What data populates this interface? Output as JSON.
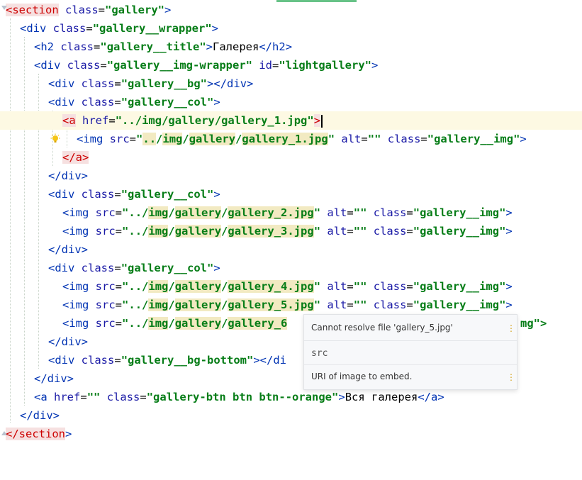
{
  "editor": {
    "lines": [
      [
        "<",
        "section",
        " class",
        "=",
        "\"gallery\"",
        ">"
      ],
      [],
      [],
      [],
      [],
      [],
      [],
      [],
      [],
      [],
      [],
      [],
      [],
      [],
      [],
      [],
      [],
      [],
      [],
      [],
      [],
      [],
      [],
      []
    ],
    "l0": {
      "lt": "<",
      "tag": "section",
      "attr": " class",
      "eq": "=",
      "val": "\"gallery\"",
      "gt": ">"
    },
    "l1": {
      "lt": "<",
      "tag": "div",
      "attr": " class",
      "eq": "=",
      "val": "\"gallery__wrapper\"",
      "gt": ">"
    },
    "l2": {
      "lt": "<",
      "tag": "h2",
      "attr": " class",
      "eq": "=",
      "val": "\"gallery__title\"",
      "gt": ">",
      "text": "Галерея",
      "close_lt": "</",
      "close_tag": "h2",
      "close_gt": ">"
    },
    "l3": {
      "lt": "<",
      "tag": "div",
      "attr": " class",
      "eq": "=",
      "val": "\"gallery__img-wrapper\"",
      "attr2": " id",
      "eq2": "=",
      "val2": "\"lightgallery\"",
      "gt": ">"
    },
    "l4": {
      "lt": "<",
      "tag": "div",
      "attr": " class",
      "eq": "=",
      "val": "\"gallery__bg\"",
      "gt": ">",
      "close_lt": "</",
      "close_tag": "div",
      "close_gt": ">"
    },
    "l5": {
      "lt": "<",
      "tag": "div",
      "attr": " class",
      "eq": "=",
      "val": "\"gallery__col\"",
      "gt": ">"
    },
    "l6": {
      "lt": "<",
      "tag": "a",
      "attr": " href",
      "eq": "=",
      "q1": "\"",
      "p1": "..",
      "s1": "/",
      "p2": "img",
      "s2": "/",
      "p3": "gallery",
      "s3": "/",
      "p4": "gallery_1.jpg",
      "q2": "\"",
      "gt": ">"
    },
    "l7": {
      "lt": "<",
      "tag": "img",
      "attr": " src",
      "eq": "=",
      "q1": "\"",
      "p1": "..",
      "s1": "/",
      "p2": "img",
      "s2": "/",
      "p3": "gallery",
      "s3": "/",
      "p4": "gallery_1.jpg",
      "q2": "\"",
      "attr2": " alt",
      "eq2": "=",
      "val2": "\"\"",
      "attr3": " class",
      "eq3": "=",
      "val3": "\"gallery__img\"",
      "gt": ">"
    },
    "l8": {
      "lt": "</",
      "tag": "a",
      "gt": ">"
    },
    "l9": {
      "lt": "</",
      "tag": "div",
      "gt": ">"
    },
    "l10": {
      "lt": "<",
      "tag": "div",
      "attr": " class",
      "eq": "=",
      "val": "\"gallery__col\"",
      "gt": ">"
    },
    "l11": {
      "lt": "<",
      "tag": "img",
      "attr": " src",
      "eq": "=",
      "q1": "\"",
      "p1": "..",
      "s1": "/",
      "p2": "img",
      "s2": "/",
      "p3": "gallery",
      "s3": "/",
      "p4": "gallery_2.jpg",
      "q2": "\"",
      "attr2": " alt",
      "eq2": "=",
      "val2": "\"\"",
      "attr3": " class",
      "eq3": "=",
      "val3": "\"gallery__img\"",
      "gt": ">"
    },
    "l12": {
      "lt": "<",
      "tag": "img",
      "attr": " src",
      "eq": "=",
      "q1": "\"",
      "p1": "..",
      "s1": "/",
      "p2": "img",
      "s2": "/",
      "p3": "gallery",
      "s3": "/",
      "p4": "gallery_3.jpg",
      "q2": "\"",
      "attr2": " alt",
      "eq2": "=",
      "val2": "\"\"",
      "attr3": " class",
      "eq3": "=",
      "val3": "\"gallery__img\"",
      "gt": ">"
    },
    "l13": {
      "lt": "</",
      "tag": "div",
      "gt": ">"
    },
    "l14": {
      "lt": "<",
      "tag": "div",
      "attr": " class",
      "eq": "=",
      "val": "\"gallery__col\"",
      "gt": ">"
    },
    "l15": {
      "lt": "<",
      "tag": "img",
      "attr": " src",
      "eq": "=",
      "q1": "\"",
      "p1": "..",
      "s1": "/",
      "p2": "img",
      "s2": "/",
      "p3": "gallery",
      "s3": "/",
      "p4": "gallery_4.jpg",
      "q2": "\"",
      "attr2": " alt",
      "eq2": "=",
      "val2": "\"\"",
      "attr3": " class",
      "eq3": "=",
      "val3": "\"gallery__img\"",
      "gt": ">"
    },
    "l16": {
      "lt": "<",
      "tag": "img",
      "attr": " src",
      "eq": "=",
      "q1": "\"",
      "p1": "..",
      "s1": "/",
      "p2": "img",
      "s2": "/",
      "p3": "gallery",
      "s3": "/",
      "p4": "gallery_5.jpg",
      "q2": "\"",
      "attr2": " alt",
      "eq2": "=",
      "val2": "\"\"",
      "attr3": " class",
      "eq3": "=",
      "val3": "\"gallery__img\"",
      "gt": ">"
    },
    "l17": {
      "lt": "<",
      "tag": "img",
      "attr": " src",
      "eq": "=",
      "q1": "\"",
      "p1": "..",
      "s1": "/",
      "p2": "img",
      "s2": "/",
      "p3": "gallery",
      "s3": "/",
      "p4": "gallery_6",
      "tail": "mg\">"
    },
    "l18": {
      "lt": "</",
      "tag": "div",
      "gt": ">"
    },
    "l19": {
      "lt": "<",
      "tag": "div",
      "attr": " class",
      "eq": "=",
      "val": "\"gallery__bg-bottom\"",
      "gt": ">",
      "close_lt": "</",
      "close_tag": "di"
    },
    "l20": {
      "lt": "</",
      "tag": "div",
      "gt": ">"
    },
    "l21": {
      "lt": "<",
      "tag": "a",
      "attr": " href",
      "eq": "=",
      "val": "\"\"",
      "attr2": " class",
      "eq2": "=",
      "val2": "\"gallery-btn btn btn--orange\"",
      "gt": ">",
      "text": "Вся галерея",
      "close_lt": "</",
      "close_tag": "a",
      "close_gt": ">"
    },
    "l22": {
      "lt": "</",
      "tag": "div",
      "gt": ">"
    },
    "l23": {
      "lt": "</",
      "tag": "section",
      "gt": ">"
    }
  },
  "popup": {
    "error_text": "Cannot resolve file 'gallery_5.jpg'",
    "attribute_name": "src",
    "description": "URI of image to embed."
  },
  "icons": {
    "bulb": "lightbulb-icon",
    "more": "more-vertical-icon"
  },
  "colors": {
    "tag": "#0033b3",
    "string": "#067d17",
    "current_line": "#fdf9e3",
    "highlight": "#f2eac2"
  }
}
